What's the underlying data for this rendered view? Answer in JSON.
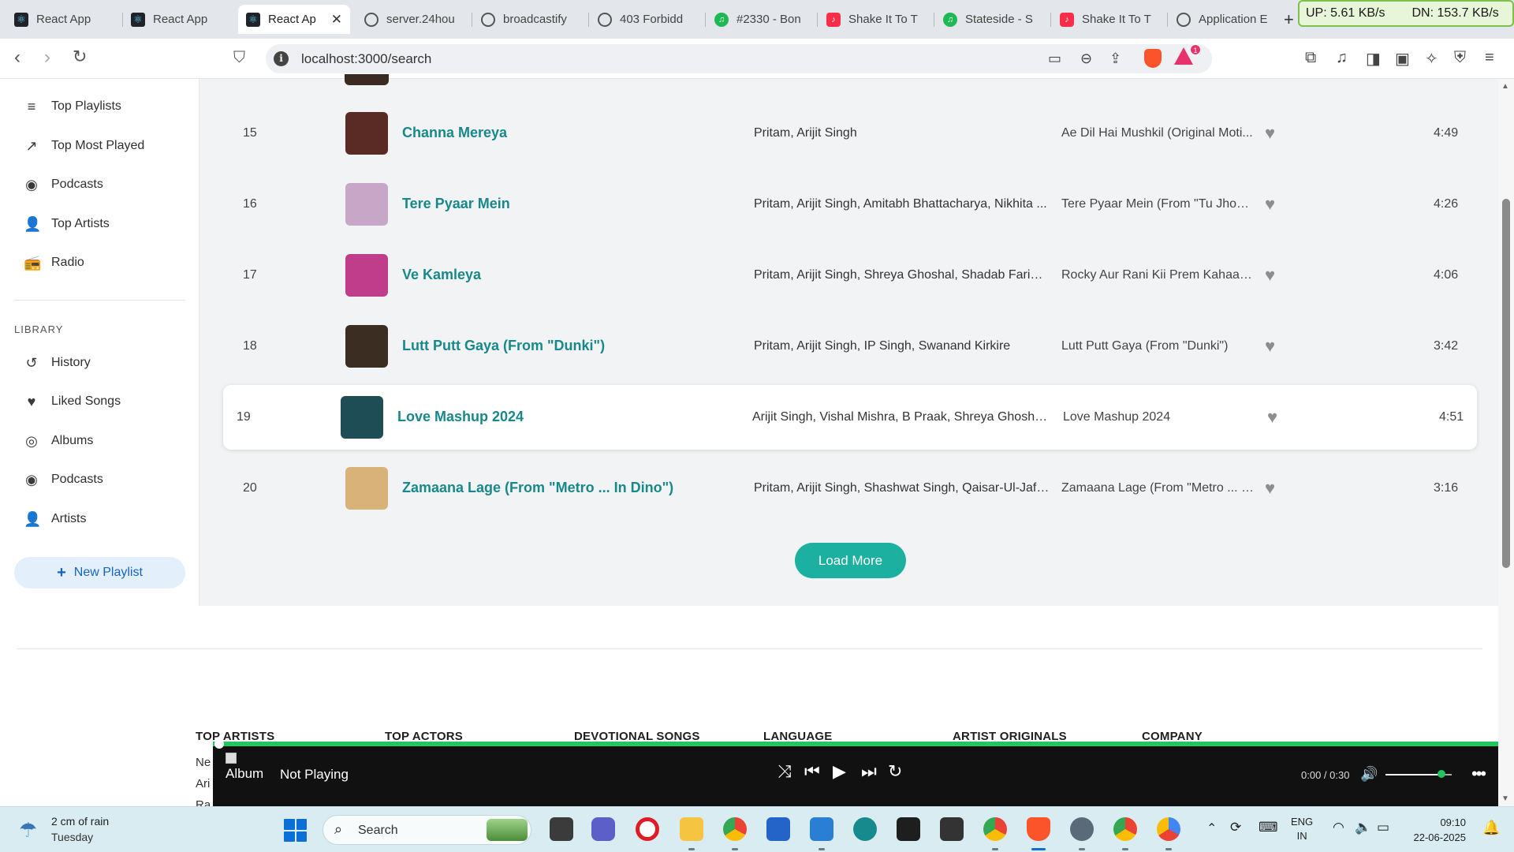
{
  "browser": {
    "tabs": [
      {
        "label": "React App",
        "icon": "react-icon",
        "active": false
      },
      {
        "label": "React App",
        "icon": "react-icon",
        "active": false
      },
      {
        "label": "React Ap",
        "icon": "react-icon",
        "active": true
      },
      {
        "label": "server.24hou",
        "icon": "globe-icon",
        "active": false
      },
      {
        "label": "broadcastify",
        "icon": "globe-icon",
        "active": false
      },
      {
        "label": "403 Forbidd",
        "icon": "globe-icon",
        "active": false
      },
      {
        "label": "#2330 - Bon",
        "icon": "spotify-icon",
        "active": false
      },
      {
        "label": "Shake It To T",
        "icon": "music-icon",
        "active": false
      },
      {
        "label": "Stateside - S",
        "icon": "spotify-icon",
        "active": false
      },
      {
        "label": "Shake It To T",
        "icon": "music-icon",
        "active": false
      },
      {
        "label": "Application E",
        "icon": "globe-icon",
        "active": false
      }
    ],
    "net_monitor": {
      "up": "UP: 5.61 KB/s",
      "down": "DN: 153.7 KB/s"
    },
    "url": "localhost:3000/search",
    "rewards_count": "1"
  },
  "sidebar": {
    "items": [
      {
        "label": "Top Playlists",
        "icon": "playlist-icon"
      },
      {
        "label": "Top Most Played",
        "icon": "trending-icon"
      },
      {
        "label": "Podcasts",
        "icon": "podcast-icon"
      },
      {
        "label": "Top Artists",
        "icon": "person-icon"
      },
      {
        "label": "Radio",
        "icon": "radio-icon"
      }
    ],
    "library_heading": "LIBRARY",
    "library_items": [
      {
        "label": "History",
        "icon": "history-icon"
      },
      {
        "label": "Liked Songs",
        "icon": "heart-icon"
      },
      {
        "label": "Albums",
        "icon": "album-icon"
      },
      {
        "label": "Podcasts",
        "icon": "podcast-icon"
      },
      {
        "label": "Artists",
        "icon": "person-icon"
      }
    ],
    "new_playlist_label": "New Playlist"
  },
  "songs": [
    {
      "index": "15",
      "title": "Channa Mereya",
      "artists": "Pritam, Arijit Singh",
      "album": "Ae Dil Hai Mushkil (Original Moti...",
      "duration": "4:49",
      "art_color": "#5a2a24"
    },
    {
      "index": "16",
      "title": "Tere Pyaar Mein",
      "artists": "Pritam, Arijit Singh, Amitabh Bhattacharya, Nikhita ...",
      "album": "Tere Pyaar Mein (From \"Tu Jhoot...",
      "duration": "4:26",
      "art_color": "#c8a6c8"
    },
    {
      "index": "17",
      "title": "Ve Kamleya",
      "artists": "Pritam, Arijit Singh, Shreya Ghoshal, Shadab Faridi, ...",
      "album": "Rocky Aur Rani Kii Prem Kahaani ...",
      "duration": "4:06",
      "art_color": "#c03d8c"
    },
    {
      "index": "18",
      "title": "Lutt Putt Gaya (From \"Dunki\")",
      "artists": "Pritam, Arijit Singh, IP Singh, Swanand Kirkire",
      "album": "Lutt Putt Gaya (From \"Dunki\")",
      "duration": "3:42",
      "art_color": "#3b2d22"
    },
    {
      "index": "19",
      "title": "Love Mashup 2024",
      "artists": "Arijit Singh, Vishal Mishra, B Praak, Shreya Ghoshal, ...",
      "album": "Love Mashup 2024",
      "duration": "4:51",
      "art_color": "#1e4d55",
      "highlighted": true
    },
    {
      "index": "20",
      "title": "Zamaana Lage (From \"Metro ... In Dino\")",
      "artists": "Pritam, Arijit Singh, Shashwat Singh, Qaisar-Ul-Jafri,...",
      "album": "Zamaana Lage (From \"Metro ... I...",
      "duration": "3:16",
      "art_color": "#d9b27a"
    }
  ],
  "load_more_label": "Load More",
  "footer": {
    "columns": [
      "TOP ARTISTS",
      "TOP ACTORS",
      "DEVOTIONAL SONGS",
      "LANGUAGE",
      "ARTIST ORIGINALS",
      "COMPANY"
    ],
    "links": [
      "Ne",
      "Ari",
      "Ra"
    ]
  },
  "player": {
    "album_alt": "Album",
    "status": "Not Playing",
    "time": "0:00 / 0:30",
    "volume_level": 0.85,
    "accent": "#22c55e"
  },
  "taskbar": {
    "weather": "2 cm of rain",
    "weather_day": "Tuesday",
    "search_placeholder": "Search",
    "language_line1": "ENG",
    "language_line2": "IN",
    "time": "09:10",
    "date": "22-06-2025"
  }
}
